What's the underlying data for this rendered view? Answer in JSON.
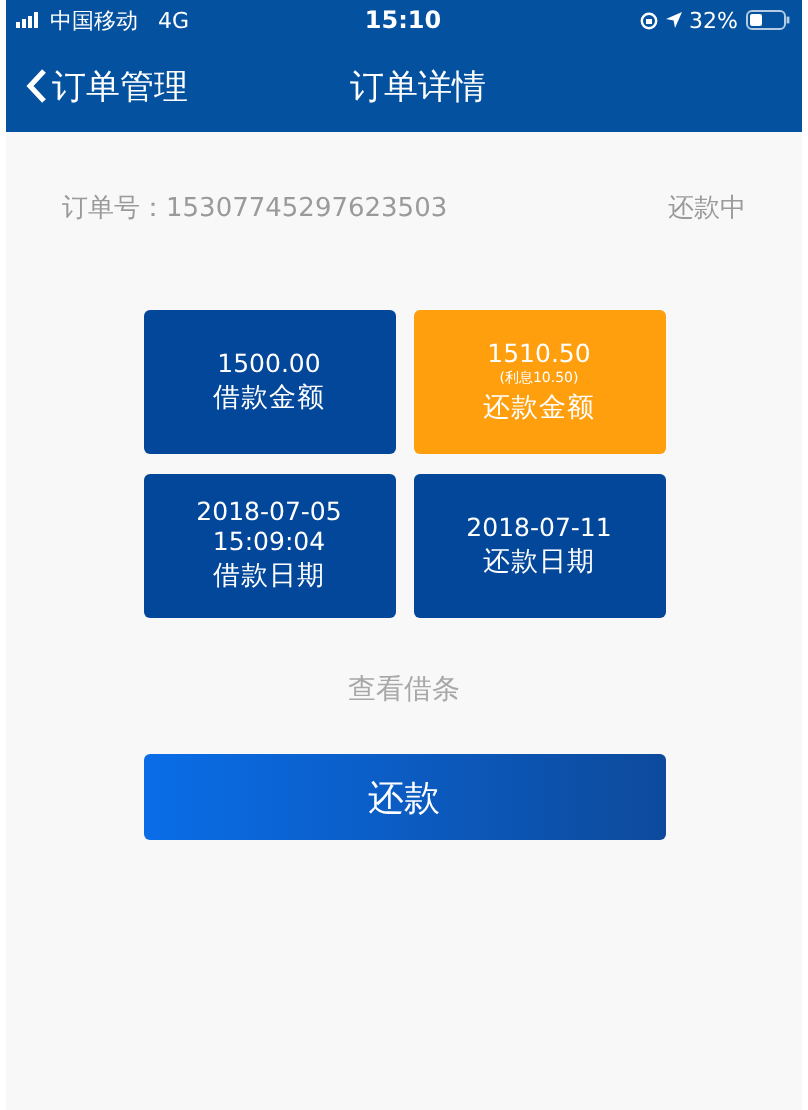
{
  "status_bar": {
    "carrier": "中国移动",
    "network": "4G",
    "time": "15:10",
    "battery": "32%"
  },
  "nav": {
    "back_label": "订单管理",
    "title": "订单详情"
  },
  "order": {
    "label": "订单号：",
    "number": "15307745297623503",
    "status": "还款中"
  },
  "tiles": [
    {
      "kind": "normal",
      "lines": [
        "1500.00"
      ],
      "caption": "借款金额"
    },
    {
      "kind": "highlight",
      "lines": [
        "1510.50"
      ],
      "note": "(利息10.50)",
      "caption": "还款金额"
    },
    {
      "kind": "normal",
      "lines": [
        "2018-07-05",
        "15:09:04"
      ],
      "caption": "借款日期"
    },
    {
      "kind": "normal",
      "lines": [
        "2018-07-11"
      ],
      "caption": "还款日期"
    }
  ],
  "link": "查看借条",
  "button": "还款"
}
